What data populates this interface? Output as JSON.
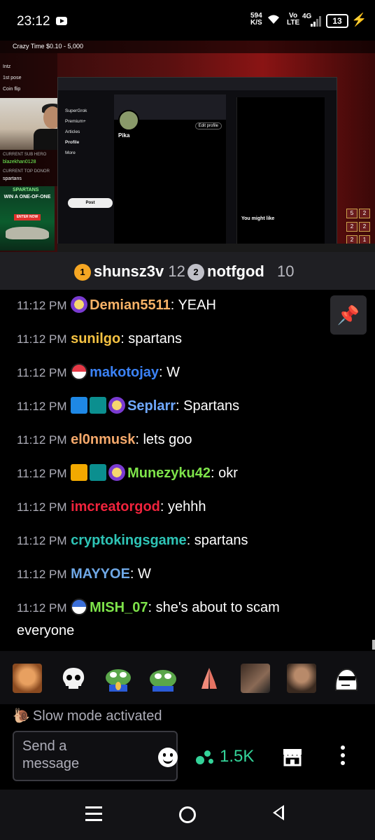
{
  "status_bar": {
    "time": "23:12",
    "net_speed": "594",
    "net_unit": "K/S",
    "volte_top": "Vo",
    "volte_bottom": "LTE",
    "network": "4G",
    "battery": "13"
  },
  "stream": {
    "top_title": "Crazy Time $0.10 - 5,000",
    "left_lines": [
      "Intz",
      "1st pose",
      "Coin flip"
    ],
    "sub_label": "CURRENT SUB HERO",
    "sub_name": "blazekhan0128",
    "sub_label2": "CURRENT TOP DONOR",
    "sub_name2": "spartans",
    "ad_brand": "SPARTANS",
    "ad_text": "WIN A ONE-OF-ONE",
    "ad_button": "ENTER NOW",
    "profile_name": "Pika",
    "follow_label": "Edit profile",
    "nav_items": [
      "SuperGrok",
      "Premium+",
      "Articles",
      "Profile",
      "More"
    ],
    "post_label": "Post",
    "side_title": "You might like",
    "dice": [
      "5",
      "2",
      "2",
      "2",
      "2",
      "1"
    ]
  },
  "leaderboard": {
    "first": {
      "rank": "1",
      "name": "shunsz3v",
      "score": "12",
      "color": "#f5a623"
    },
    "second": {
      "rank": "2",
      "name": "notfgod",
      "score": "10",
      "color": "#c0c0c8"
    }
  },
  "chat": {
    "messages": [
      {
        "time": "11:12 PM",
        "user": "Demian5511",
        "text": ": YEAH",
        "color": "#f7b267"
      },
      {
        "time": "11:12 PM",
        "user": "sunilgo",
        "text": ": spartans",
        "color": "#f5c242"
      },
      {
        "time": "11:12 PM",
        "user": "makotojay",
        "text": ": W",
        "color": "#3b82f6"
      },
      {
        "time": "11:12 PM",
        "user": "Seplarr",
        "text": ": Spartans",
        "color": "#6fa8ff"
      },
      {
        "time": "11:12 PM",
        "user": "el0nmusk",
        "text": ": lets goo",
        "color": "#f6a96b"
      },
      {
        "time": "11:12 PM",
        "user": "Munezyku42",
        "text": ": okr",
        "color": "#7ee34a"
      },
      {
        "time": "11:12 PM",
        "user": "imcreatorgod",
        "text": ": yehhh",
        "color": "#ef233c"
      },
      {
        "time": "11:12 PM",
        "user": "cryptokingsgame",
        "text": ": spartans",
        "color": "#2ec4b6"
      },
      {
        "time": "11:12 PM",
        "user": "MAYYOE",
        "text": ": W",
        "color": "#6fa8e6"
      },
      {
        "time": "11:12 PM",
        "user": "MISH_07",
        "text": ": she's about to scam",
        "text2": "everyone",
        "color": "#7ee34a"
      }
    ],
    "pin_icon": "pin-icon"
  },
  "emotes": [
    "laughing-face-emote",
    "skull-emote",
    "pepe-pray-emote",
    "pepe-emote",
    "pray-hands-emote",
    "gif-emote",
    "bearded-man-emote",
    "doge-sunglasses-emote"
  ],
  "slow_mode": "Slow mode activated",
  "input": {
    "placeholder": "Send a message",
    "points": "1.5K"
  },
  "colors": {
    "accent_green": "#34d399",
    "background": "#000000",
    "leaderboard_bg": "#1f1f23"
  }
}
